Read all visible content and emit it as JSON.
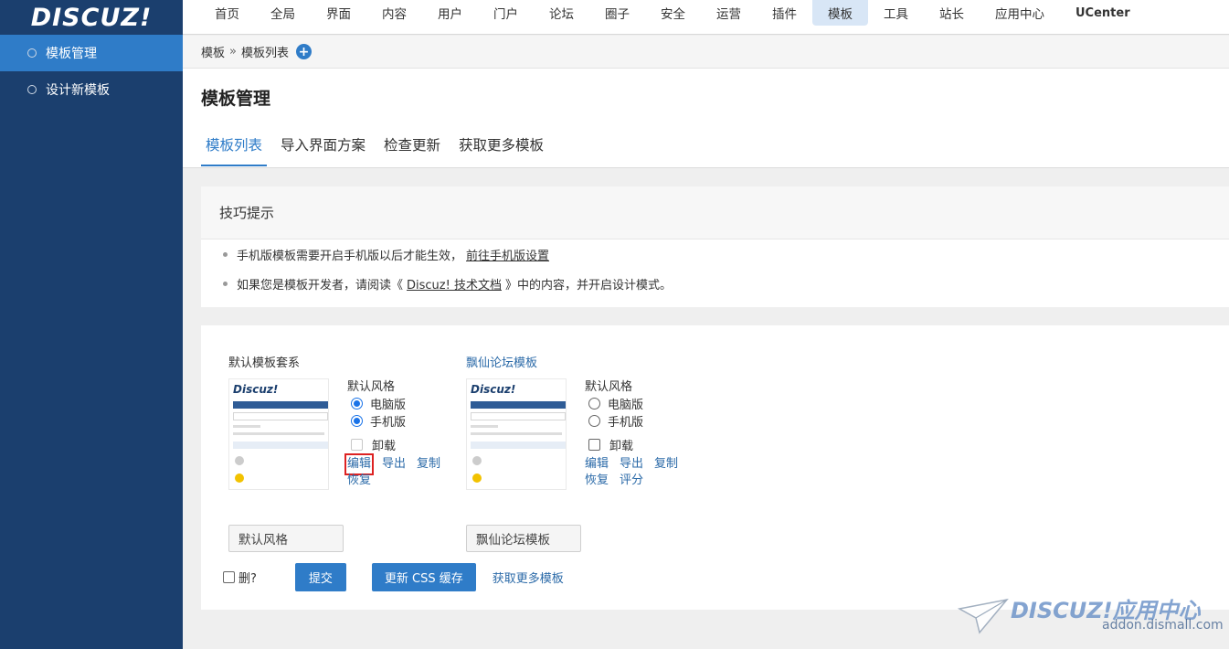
{
  "brand": {
    "logo": "DISCUZ!"
  },
  "topnav": {
    "items": [
      "首页",
      "全局",
      "界面",
      "内容",
      "用户",
      "门户",
      "论坛",
      "圈子",
      "安全",
      "运营",
      "插件",
      "模板",
      "工具",
      "站长",
      "应用中心",
      "UCenter"
    ],
    "active": "模板"
  },
  "sidebar": {
    "items": [
      {
        "label": "模板管理",
        "active": true
      },
      {
        "label": "设计新模板",
        "active": false
      }
    ]
  },
  "breadcrumb": {
    "root": "模板",
    "separator": "»",
    "current": "模板列表"
  },
  "page": {
    "title": "模板管理",
    "tabs": [
      "模板列表",
      "导入界面方案",
      "检查更新",
      "获取更多模板"
    ],
    "active_tab": "模板列表"
  },
  "tips": {
    "title": "技巧提示",
    "line1_text": "手机版模板需要开启手机版以后才能生效，",
    "line1_link": "前往手机版设置",
    "line2_pre": "如果您是模板开发者，请阅读《",
    "line2_link": "Discuz! 技术文档",
    "line2_post": "》中的内容，并开启设计模式。"
  },
  "templates": [
    {
      "title": "默认模板套系",
      "style_label": "默认风格",
      "pc_label": "电脑版",
      "mobile_label": "手机版",
      "pc_selected": true,
      "mobile_selected": true,
      "uninstall_label": "卸载",
      "uninstall_disabled": true,
      "links": [
        "编辑",
        "导出",
        "复制",
        "恢复"
      ],
      "name_value": "默认风格",
      "thumb_logo": "Discuz!"
    },
    {
      "title": "飘仙论坛模板",
      "style_label": "默认风格",
      "pc_label": "电脑版",
      "mobile_label": "手机版",
      "pc_selected": false,
      "mobile_selected": false,
      "uninstall_label": "卸载",
      "uninstall_disabled": false,
      "links": [
        "编辑",
        "导出",
        "复制",
        "恢复",
        "评分"
      ],
      "name_value": "飘仙论坛模板",
      "thumb_logo": "Discuz!"
    }
  ],
  "actions": {
    "delete_label": "删?",
    "submit_label": "提交",
    "css_label": "更新 CSS 缓存",
    "more_label": "获取更多模板"
  },
  "watermark": {
    "brand": "DISCUZ!应用中心",
    "url": "addon.dismall.com"
  },
  "colors": {
    "sidebar": "#1b3f6e",
    "accent": "#2f7cc8",
    "link": "#2b6aa8",
    "highlight_box": "#dd2222"
  }
}
